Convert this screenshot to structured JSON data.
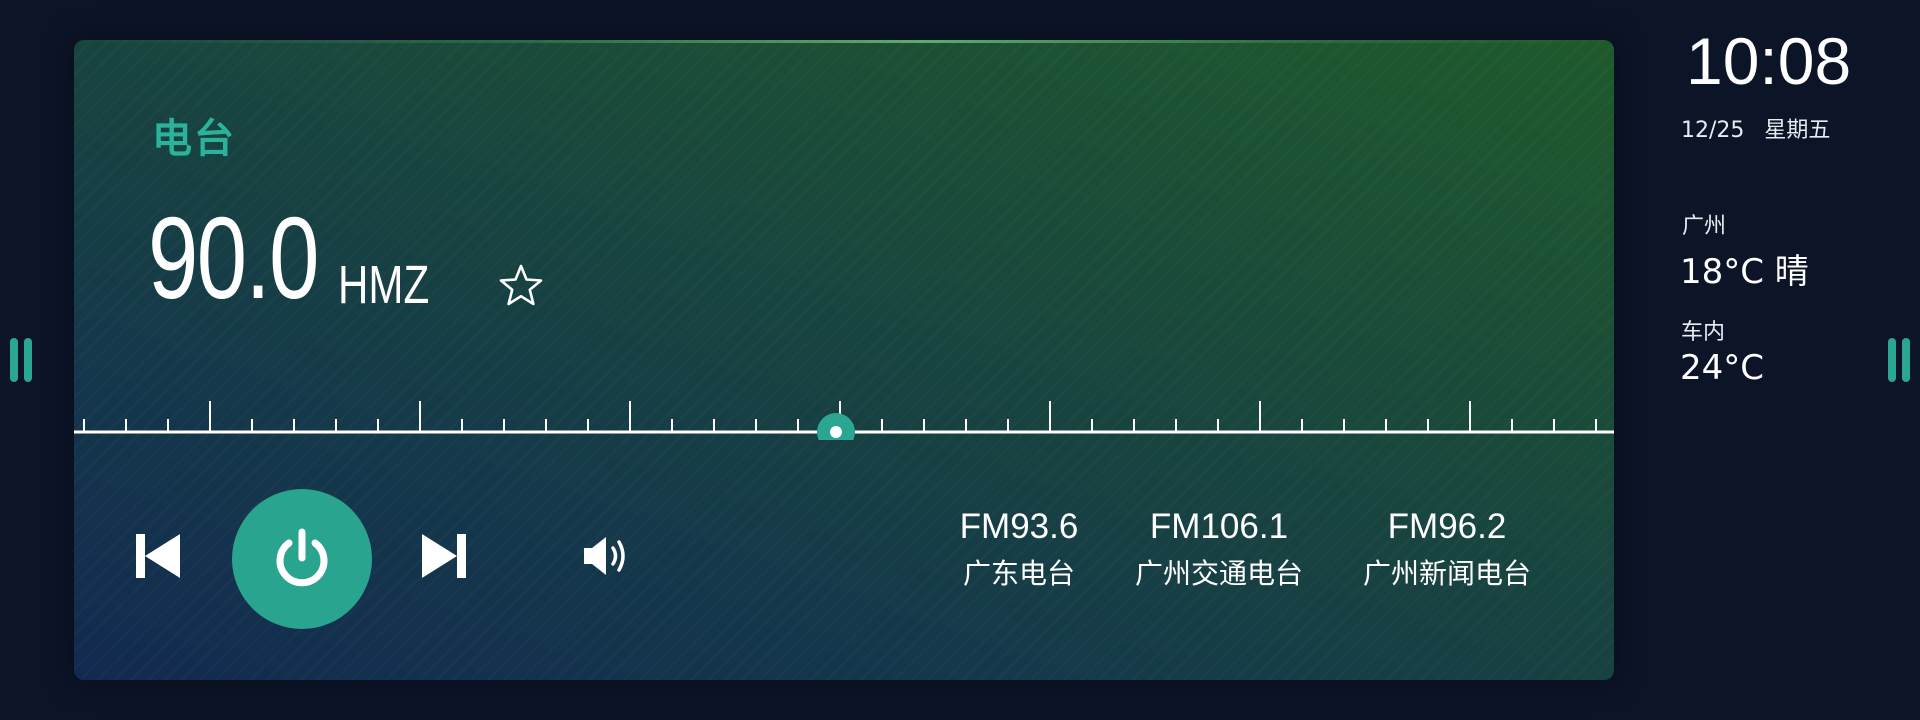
{
  "app": {
    "section_title": "电台",
    "frequency": "90.0",
    "unit": "HMZ",
    "favorite_icon": "star-outline-icon",
    "tuner": {
      "range_min": 87.5,
      "range_max": 108,
      "current": 90.0,
      "accent": "#2aa693"
    }
  },
  "controls": {
    "prev_icon": "skip-previous-icon",
    "power_icon": "power-icon",
    "next_icon": "skip-next-icon",
    "volume_icon": "volume-icon",
    "power_color": "#29a48e"
  },
  "presets": [
    {
      "freq": "FM93.6",
      "name": "广东电台"
    },
    {
      "freq": "FM106.1",
      "name": "广州交通电台"
    },
    {
      "freq": "FM96.2",
      "name": "广州新闻电台"
    }
  ],
  "status": {
    "time": "10:08",
    "date": "12/25",
    "weekday": "星期五",
    "city": "广州",
    "outdoor": "18°C 晴",
    "indoor_label": "车内",
    "indoor_temp": "24°C"
  }
}
